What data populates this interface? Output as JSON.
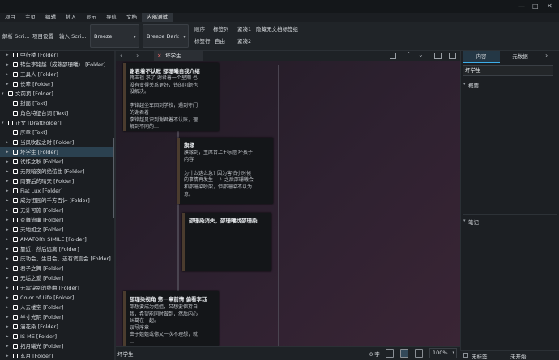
{
  "window": {
    "min_icon": "—",
    "max_icon": "□",
    "close_icon": "✕"
  },
  "menu": [
    "项目",
    "主页",
    "编辑",
    "插入",
    "显示",
    "导航",
    "文档",
    "内部测试"
  ],
  "toolbar": {
    "btn1": "解析 Scri...",
    "btn2": "项目设置",
    "btn3": "输入 Scri...",
    "combo1": "Breeze",
    "combo2": "Breeze Dark",
    "r1": [
      "顺序",
      "标签列",
      "紧凑1",
      "隐藏无文档标签组"
    ],
    "r2": [
      "标签行",
      "自由",
      "紧凑2"
    ]
  },
  "tree": [
    {
      "label": "中行楼 [Folder]",
      "indent": 2,
      "arrow": "▸"
    },
    {
      "label": "转生李铭越（成熟邵珊曦） [Folder]",
      "indent": 2,
      "arrow": "▸"
    },
    {
      "label": "工具人 [Folder]",
      "indent": 2,
      "arrow": "▸"
    },
    {
      "label": "长辈 [Folder]",
      "indent": 2,
      "arrow": "▸"
    },
    {
      "label": "文前页 [Folder]",
      "indent": 1,
      "arrow": "▾"
    },
    {
      "label": "封面 [Text]",
      "indent": 2,
      "arrow": ""
    },
    {
      "label": "角色特征台词 [Text]",
      "indent": 2,
      "arrow": ""
    },
    {
      "label": "正文 [DraftFolder]",
      "indent": 1,
      "arrow": "▾"
    },
    {
      "label": "序章 [Text]",
      "indent": 2,
      "arrow": ""
    },
    {
      "label": "当风吹起之时 [Folder]",
      "indent": 2,
      "arrow": "▸"
    },
    {
      "label": "坏学生 [Folder]",
      "indent": 2,
      "arrow": "▸",
      "selected": true
    },
    {
      "label": "试炼之秋 [Folder]",
      "indent": 2,
      "arrow": "▸"
    },
    {
      "label": "无限暗夜的绝弦曲 [Folder]",
      "indent": 2,
      "arrow": "▸"
    },
    {
      "label": "雨賽后的晴天 [Folder]",
      "indent": 2,
      "arrow": "▸"
    },
    {
      "label": "Fiat Lux [Folder]",
      "indent": 2,
      "arrow": "▸"
    },
    {
      "label": "成为祖园的千方百计 [Folder]",
      "indent": 2,
      "arrow": "▸"
    },
    {
      "label": "无计可施 [Folder]",
      "indent": 2,
      "arrow": "▸"
    },
    {
      "label": "炎舞流廉 [Folder]",
      "indent": 2,
      "arrow": "▸"
    },
    {
      "label": "天地如之 [Folder]",
      "indent": 2,
      "arrow": "▸"
    },
    {
      "label": "AMATORY SIMILE [Folder]",
      "indent": 2,
      "arrow": "▸"
    },
    {
      "label": "靠近，然后远离 [Folder]",
      "indent": 2,
      "arrow": "▸"
    },
    {
      "label": "庆功会、生日会，还有谎言会 [Folder]",
      "indent": 2,
      "arrow": "▸"
    },
    {
      "label": "君子之舞 [Folder]",
      "indent": 2,
      "arrow": "▸"
    },
    {
      "label": "无垢之爱 [Folder]",
      "indent": 2,
      "arrow": "▸"
    },
    {
      "label": "无需诀别的终曲 [Folder]",
      "indent": 2,
      "arrow": "▸"
    },
    {
      "label": "Color of Life [Folder]",
      "indent": 2,
      "arrow": "▸"
    },
    {
      "label": "人去楼空 [Folder]",
      "indent": 2,
      "arrow": "▸"
    },
    {
      "label": "半寸光阴 [Folder]",
      "indent": 2,
      "arrow": "▸"
    },
    {
      "label": "漫花染 [Folder]",
      "indent": 2,
      "arrow": "▸"
    },
    {
      "label": "IS ME [Folder]",
      "indent": 2,
      "arrow": "▸"
    },
    {
      "label": "拓月曦光 [Folder]",
      "indent": 2,
      "arrow": "▸"
    },
    {
      "label": "玄月 [Folder]",
      "indent": 2,
      "arrow": "▸"
    }
  ],
  "editor": {
    "tab_label": "坏学生",
    "close_icon": "✕",
    "cards": [
      {
        "title": "谢君着不认账 邵珊曦自我介绍",
        "body": "蒋玉祖 求了 谢君着一个星期 也\n没有变得关系更好，钱的问题也\n没解决。\n\n李铭越坐车回到学校，遇到守门\n的谢君着\n李铭越见识到谢君着不认账，理\n解到不同的…"
      },
      {
        "title": "旗缘",
        "body": "旗缘到，主席台上+标题 坏孩子\n内容\n\n为什么这么急? 因为害怕小时候\n的事情再发生 —〉之后邵珊曦会\n和邵珊染吵架，但邵珊染不以为\n意。"
      },
      {
        "title": "邵珊染消失，邵珊曦找邵珊染",
        "body": ""
      },
      {
        "title": "邵珊染视角 第一章前情 偏看李珏",
        "body": "邵想要成为姐姐，又想要保持自\n我，希望能同时做到，然后内心\n纠葛在一起。\n误导序章\n由于姐姐或德又一次不理想，就\n…"
      }
    ],
    "status_title": "坏学生",
    "word_count": "0 字",
    "zoom": "100%"
  },
  "inspector": {
    "tabs": [
      "内容",
      "元数据"
    ],
    "title": "坏学生",
    "summary_label": "概要",
    "notes_label": "笔记",
    "label_none": "无标签",
    "status_label": "未开始"
  },
  "colors": {
    "accent": "#3daee9",
    "selection": "#2b4150",
    "folder_icon": "#ffffff"
  }
}
